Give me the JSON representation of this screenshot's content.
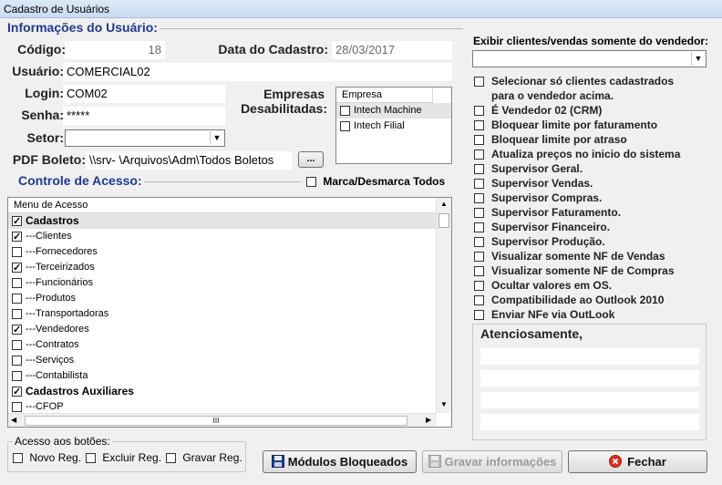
{
  "window": {
    "title": "Cadastro de Usuários"
  },
  "user_info": {
    "group_title": "Informações do Usuário:",
    "codigo_label": "Código:",
    "codigo_value": "18",
    "data_label": "Data do Cadastro:",
    "data_value": "28/03/2017",
    "usuario_label": "Usuário:",
    "usuario_value": "COMERCIAL02",
    "login_label": "Login:",
    "login_value": "COM02",
    "senha_label": "Senha:",
    "senha_value": "*****",
    "setor_label": "Setor:",
    "setor_value": "",
    "pdf_label": "PDF Boleto:",
    "pdf_value": "\\\\srv-          \\Arquivos\\Adm\\Todos Boletos",
    "browse_label": "...",
    "empresas_label_1": "Empresas",
    "empresas_label_2": "Desabilitadas:",
    "empresas_header": "Empresa",
    "empresas": [
      {
        "label": "Intech Machine",
        "checked": false
      },
      {
        "label": "Intech Filial",
        "checked": false
      }
    ]
  },
  "access": {
    "group_title": "Controle de Acesso:",
    "toggle_all_label": "Marca/Desmarca Todos",
    "menu_header": "Menu de Acesso",
    "menu_items": [
      {
        "label": "Cadastros",
        "checked": true,
        "bold": true
      },
      {
        "label": "---Clientes",
        "checked": true,
        "bold": false
      },
      {
        "label": "---Fornecedores",
        "checked": false,
        "bold": false
      },
      {
        "label": "---Terceirizados",
        "checked": true,
        "bold": false
      },
      {
        "label": "---Funcionários",
        "checked": false,
        "bold": false
      },
      {
        "label": "---Produtos",
        "checked": false,
        "bold": false
      },
      {
        "label": "---Transportadoras",
        "checked": false,
        "bold": false
      },
      {
        "label": "---Vendedores",
        "checked": true,
        "bold": false
      },
      {
        "label": "---Contratos",
        "checked": false,
        "bold": false
      },
      {
        "label": "---Serviços",
        "checked": false,
        "bold": false
      },
      {
        "label": "---Contabilista",
        "checked": false,
        "bold": false
      },
      {
        "label": "Cadastros Auxiliares",
        "checked": true,
        "bold": true
      },
      {
        "label": "---CFOP",
        "checked": false,
        "bold": false
      }
    ],
    "hscroll_grip": "III"
  },
  "buttons_access": {
    "title": "Acesso aos botões:",
    "novo": "Novo Reg.",
    "excluir": "Excluir Reg.",
    "gravar": "Gravar Reg."
  },
  "right_panel": {
    "vendedor_label": "Exibir clientes/vendas somente do vendedor:",
    "vendedor_value": "",
    "options": [
      {
        "label": "Selecionar só clientes cadastrados",
        "label2": "para o vendedor acima.",
        "checked": false
      },
      {
        "label": "É Vendedor 02 (CRM)",
        "checked": false
      },
      {
        "label": "Bloquear limite por faturamento",
        "checked": false
      },
      {
        "label": "Bloquear limite por atraso",
        "checked": false
      },
      {
        "label": "Atualiza preços no inicio do sistema",
        "checked": false
      },
      {
        "label": "Supervisor Geral.",
        "checked": false
      },
      {
        "label": "Supervisor Vendas.",
        "checked": false
      },
      {
        "label": "Supervisor Compras.",
        "checked": false
      },
      {
        "label": "Supervisor Faturamento.",
        "checked": false
      },
      {
        "label": "Supervisor Financeiro.",
        "checked": false
      },
      {
        "label": "Supervisor Produção.",
        "checked": false
      },
      {
        "label": "Visualizar somente NF de Vendas",
        "checked": false
      },
      {
        "label": "Visualizar somente NF de Compras",
        "checked": false
      },
      {
        "label": "Ocultar valores em OS.",
        "checked": false
      },
      {
        "label": "Compatibilidade ao Outlook 2010",
        "checked": false
      },
      {
        "label": "Enviar NFe via OutLook",
        "checked": false
      }
    ],
    "signature_title": "Atenciosamente,"
  },
  "actions": {
    "modulos": "Módulos Bloqueados",
    "gravar": "Gravar informações",
    "fechar": "Fechar"
  },
  "colors": {
    "group_title": "#1f3a93",
    "fechar_icon": "#e03020",
    "save_icon": "#1d3f8f"
  }
}
